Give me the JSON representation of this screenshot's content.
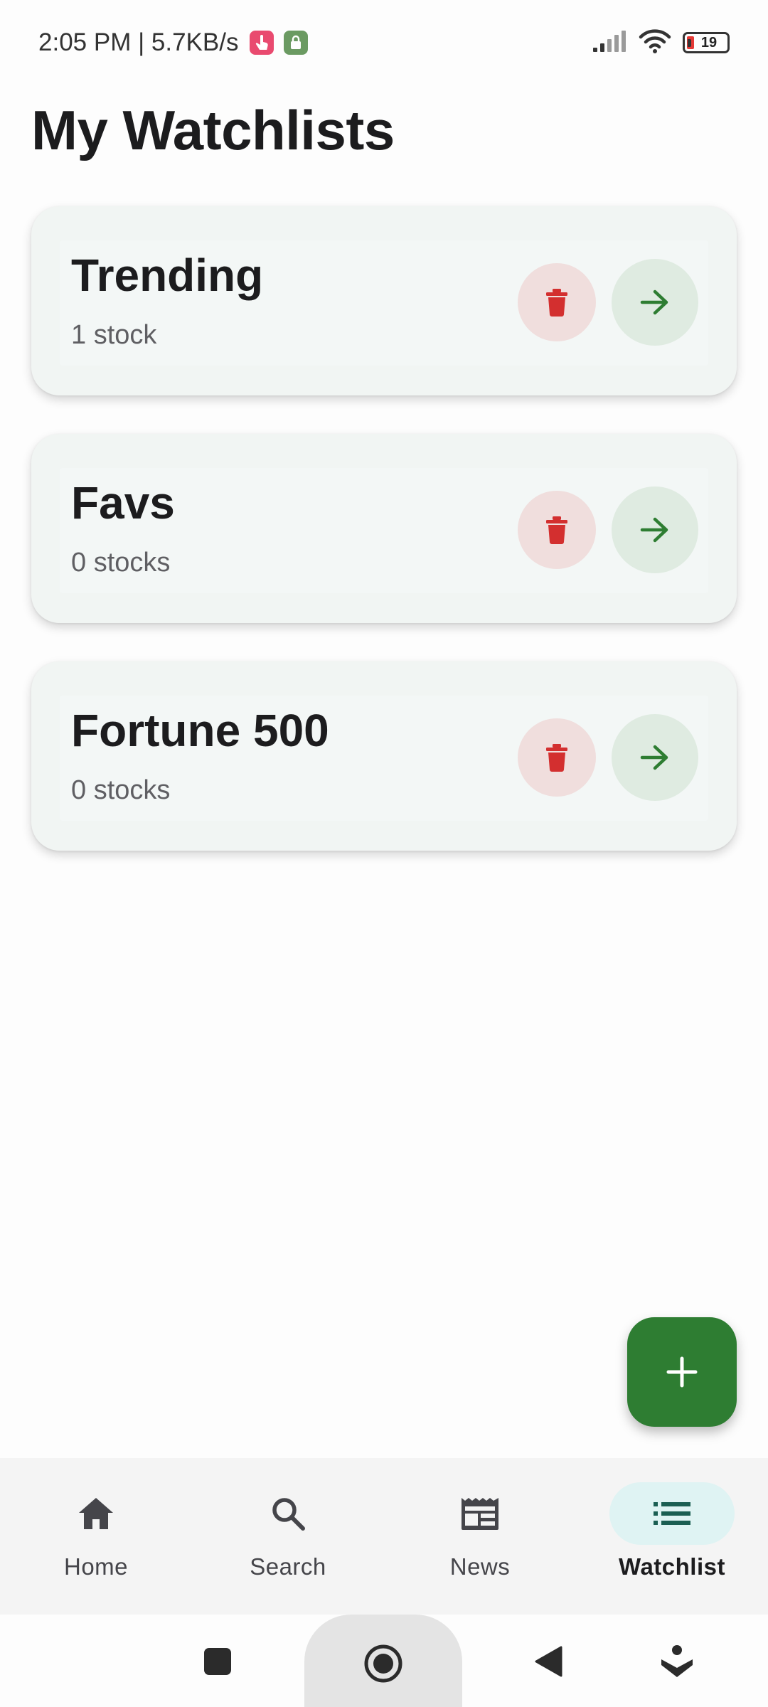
{
  "status_bar": {
    "time_speed": "2:05 PM | 5.7KB/s",
    "battery": "19",
    "icons": [
      "touch-app-icon",
      "vpn-lock-icon",
      "signal-icon",
      "wifi-icon",
      "battery-icon"
    ],
    "battery_color": "#e53935"
  },
  "header": {
    "title": "My Watchlists"
  },
  "watchlists": [
    {
      "name": "Trending",
      "count_text": "1 stock"
    },
    {
      "name": "Favs",
      "count_text": "0 stocks"
    },
    {
      "name": "Fortune 500",
      "count_text": "0 stocks"
    }
  ],
  "fab": {
    "icon": "plus-icon",
    "color": "#2e7d32"
  },
  "bottom_nav": {
    "items": [
      {
        "label": "Home",
        "icon": "home-icon",
        "active": false
      },
      {
        "label": "Search",
        "icon": "search-icon",
        "active": false
      },
      {
        "label": "News",
        "icon": "news-icon",
        "active": false
      },
      {
        "label": "Watchlist",
        "icon": "list-icon",
        "active": true
      }
    ]
  },
  "colors": {
    "delete_icon": "#d32f2f",
    "open_icon": "#2e7d32",
    "active_nav_bg": "#dff3f3"
  }
}
